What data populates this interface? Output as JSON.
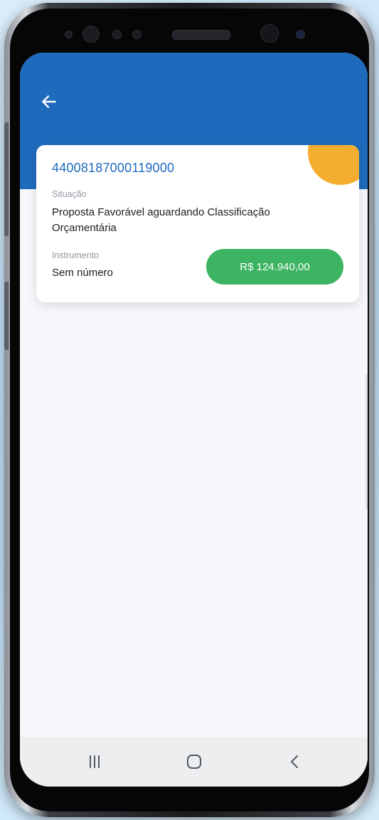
{
  "header": {
    "back_icon": "arrow-left-icon",
    "background_color": "#1e6bbd"
  },
  "card": {
    "id_number": "44008187000119000",
    "status_label": "Situação",
    "status_value": "Proposta Favorável aguardando Classificação Orçamentária",
    "instrument_label": "Instrumento",
    "instrument_value": "Sem número",
    "amount": "R$ 124.940,00",
    "bookmark_icon": "bookmark-icon",
    "accent_color": "#f4ad2e",
    "amount_color": "#3cb462"
  },
  "nav_bar": {
    "recents_icon": "recents-icon",
    "home_icon": "home-icon",
    "back_icon": "chevron-left-icon"
  }
}
